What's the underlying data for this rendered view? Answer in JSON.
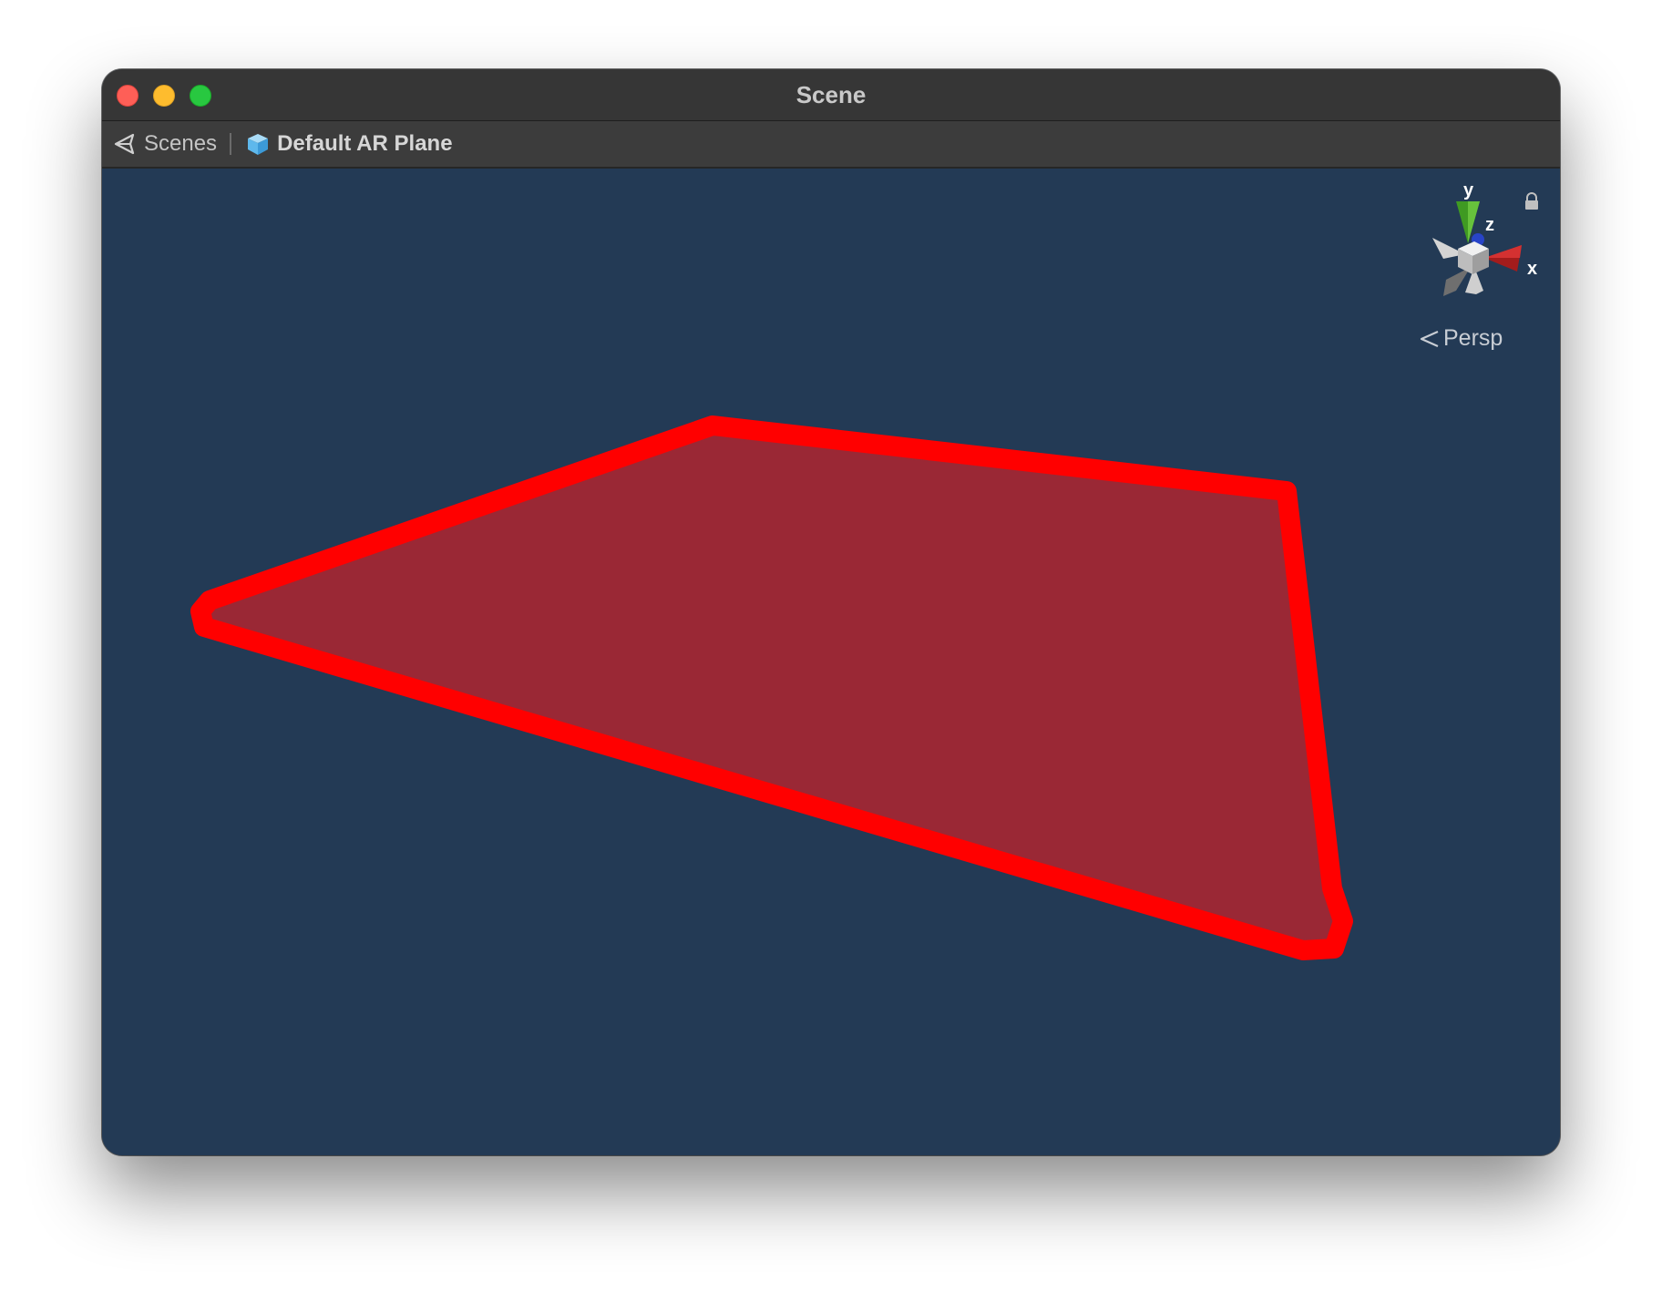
{
  "window": {
    "title": "Scene"
  },
  "breadcrumb": {
    "items": [
      {
        "label": "Scenes",
        "icon": "unity-scenes-icon"
      },
      {
        "label": "Default AR Plane",
        "icon": "prefab-cube-icon"
      }
    ]
  },
  "viewport": {
    "background_color": "#233a55",
    "plane_fill_color": "#9a2835",
    "plane_border_color": "#ff0000",
    "projection_label": "Persp",
    "gizmo_axes": {
      "x": "x",
      "y": "y",
      "z": "z"
    }
  }
}
